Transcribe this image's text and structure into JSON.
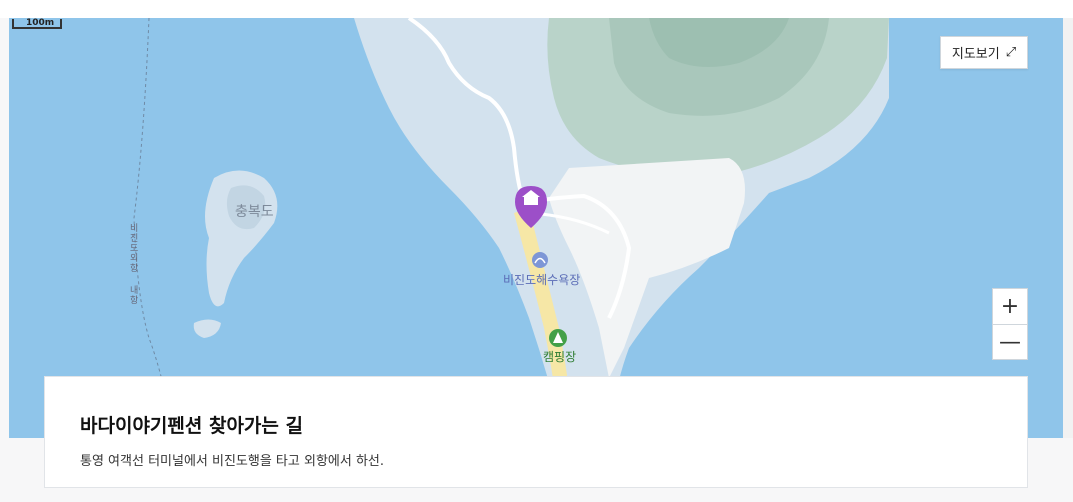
{
  "map": {
    "scale_label": "100m",
    "view_map_label": "지도보기",
    "zoom_in": "+",
    "zoom_out": "—",
    "labels": {
      "island": "충복도",
      "beach": "비진도해수욕장",
      "camping": "캠핑장",
      "route_a": "비진도외항",
      "route_b": "내항"
    },
    "colors": {
      "sea": "#8fc5ea",
      "land": "#d3e2ee",
      "forest": "#b9d3c9",
      "beach": "#f6e7a6",
      "marker": "#9c4fc8"
    }
  },
  "info": {
    "title": "바다이야기펜션 찾아가는 길",
    "description": "통영 여객선 터미널에서 비진도행을 타고 외항에서 하선."
  }
}
